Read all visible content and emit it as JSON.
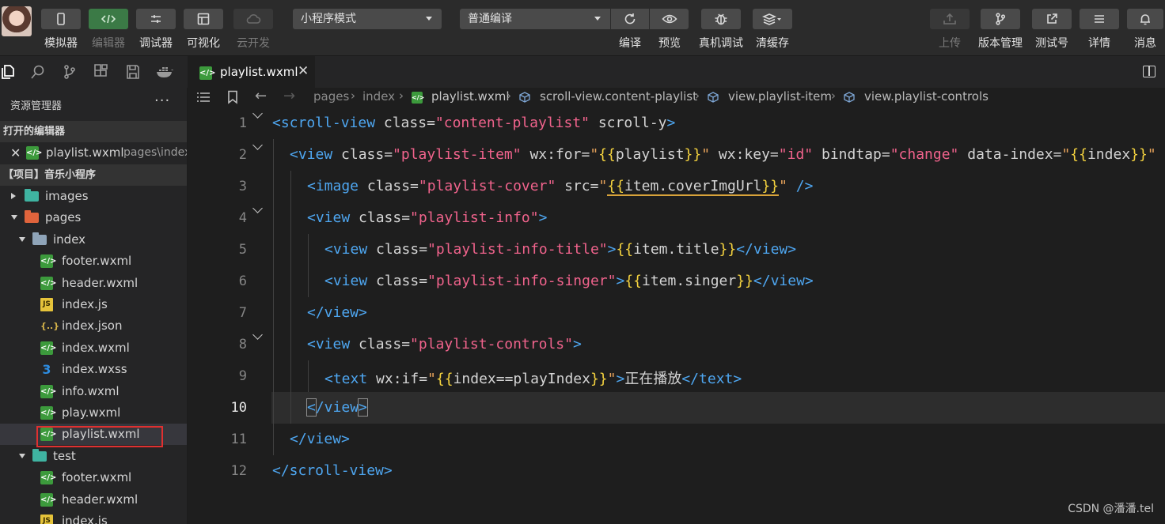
{
  "toolbar": {
    "left_buttons": [
      {
        "label": "模拟器",
        "icon": "phone-icon"
      },
      {
        "label": "编辑器",
        "icon": "code-icon"
      },
      {
        "label": "调试器",
        "icon": "debug-icon"
      },
      {
        "label": "可视化",
        "icon": "layout-icon"
      },
      {
        "label": "云开发",
        "icon": "cloud-icon"
      }
    ],
    "mode_select": "小程序模式",
    "compile_select": "普通编译",
    "mid_buttons": [
      {
        "label": "编译",
        "icon": "refresh-icon"
      },
      {
        "label": "预览",
        "icon": "eye-icon"
      },
      {
        "label": "真机调试",
        "icon": "bug-icon"
      },
      {
        "label": "清缓存",
        "icon": "layers-icon"
      }
    ],
    "right_buttons": [
      {
        "label": "上传",
        "icon": "upload-icon"
      },
      {
        "label": "版本管理",
        "icon": "branch-icon"
      },
      {
        "label": "测试号",
        "icon": "external-link-icon"
      },
      {
        "label": "详情",
        "icon": "menu-icon"
      },
      {
        "label": "消息",
        "icon": "bell-icon"
      }
    ]
  },
  "sidebar": {
    "title": "资源管理器",
    "more": "···",
    "open_editors_header": "打开的编辑器",
    "open_editor": {
      "name": "playlist.wxml",
      "hint": "pages\\index"
    },
    "project_header": "【项目】音乐小程序",
    "tree": [
      {
        "name": "images",
        "kind": "folder",
        "color": "#3fb3a1",
        "state": "closed",
        "depth": 0
      },
      {
        "name": "pages",
        "kind": "folder",
        "color": "#e0643c",
        "state": "open",
        "depth": 0
      },
      {
        "name": "index",
        "kind": "folder",
        "color": "#8fa4b8",
        "state": "open",
        "depth": 1
      },
      {
        "name": "footer.wxml",
        "kind": "wxml",
        "depth": 2
      },
      {
        "name": "header.wxml",
        "kind": "wxml",
        "depth": 2
      },
      {
        "name": "index.js",
        "kind": "js",
        "depth": 2
      },
      {
        "name": "index.json",
        "kind": "json",
        "depth": 2
      },
      {
        "name": "index.wxml",
        "kind": "wxml",
        "depth": 2
      },
      {
        "name": "index.wxss",
        "kind": "wxss",
        "depth": 2
      },
      {
        "name": "info.wxml",
        "kind": "wxml",
        "depth": 2
      },
      {
        "name": "play.wxml",
        "kind": "wxml",
        "depth": 2
      },
      {
        "name": "playlist.wxml",
        "kind": "wxml",
        "depth": 2,
        "selected": true
      },
      {
        "name": "test",
        "kind": "folder",
        "color": "#3fb3a1",
        "state": "open",
        "depth": 1
      },
      {
        "name": "footer.wxml",
        "kind": "wxml",
        "depth": 2
      },
      {
        "name": "header.wxml",
        "kind": "wxml",
        "depth": 2
      },
      {
        "name": "index.js",
        "kind": "js",
        "depth": 2
      }
    ]
  },
  "editor": {
    "tab": {
      "label": "playlist.wxml",
      "close": "✕"
    },
    "breadcrumb": [
      "pages",
      "index",
      "playlist.wxml",
      "scroll-view.content-playlist",
      "view.playlist-item",
      "view.playlist-controls"
    ],
    "active_line": 10,
    "lines": [
      {
        "n": "1"
      },
      {
        "n": "2"
      },
      {
        "n": "3"
      },
      {
        "n": "4"
      },
      {
        "n": "5"
      },
      {
        "n": "6"
      },
      {
        "n": "7"
      },
      {
        "n": "8"
      },
      {
        "n": "9"
      },
      {
        "n": "10"
      },
      {
        "n": "11"
      },
      {
        "n": "12"
      }
    ],
    "code": {
      "l1": {
        "open": "<scroll-view",
        "a1": " class=",
        "v1": "\"content-playlist\"",
        "a2": " scroll-y",
        "close": ">"
      },
      "l2": {
        "open": "<view",
        "a1": " class=",
        "v1": "\"playlist-item\"",
        "a2": " wx:for=",
        "v2a": "\"",
        "b1": "{{",
        "v2b": "playlist",
        "b2": "}}",
        "v2c": "\"",
        "a3": " wx:key=",
        "v3": "\"id\"",
        "a4": " bindtap=",
        "v4": "\"change\"",
        "a5": " data-index=",
        "v5a": "\"",
        "b3": "{{",
        "v5b": "index",
        "b4": "}}",
        "v5c": "\""
      },
      "l3": {
        "open": "<image",
        "a1": " class=",
        "v1": "\"playlist-cover\"",
        "a2": " src=",
        "v2a": "\"",
        "b1": "{{",
        "v2b": "item.coverImgUrl",
        "b2": "}}",
        "v2c": "\"",
        "close": " />"
      },
      "l4": {
        "open": "<view",
        "a1": " class=",
        "v1": "\"playlist-info\"",
        "close": ">"
      },
      "l5": {
        "open": "<view",
        "a1": " class=",
        "v1": "\"playlist-info-title\"",
        "close": ">",
        "b1": "{{",
        "t": "item.title",
        "b2": "}}",
        "end": "</view>"
      },
      "l6": {
        "open": "<view",
        "a1": " class=",
        "v1": "\"playlist-info-singer\"",
        "close": ">",
        "b1": "{{",
        "t": "item.singer",
        "b2": "}}",
        "end": "</view>"
      },
      "l7": {
        "end": "</view>"
      },
      "l8": {
        "open": "<view",
        "a1": " class=",
        "v1": "\"playlist-controls\"",
        "close": ">"
      },
      "l9": {
        "open": "<text",
        "a1": " wx:if=",
        "v1a": "\"",
        "b1": "{{",
        "v1b": "index==playIndex",
        "b2": "}}",
        "v1c": "\"",
        "close": ">",
        "t": "正在播放",
        "end": "</text>"
      },
      "l10": {
        "lt": "<",
        "end": "/view",
        "gt": ">"
      },
      "l11": {
        "end": "</view>"
      },
      "l12": {
        "end": "</scroll-view>"
      }
    }
  },
  "watermark": "CSDN @潘潘.tel"
}
